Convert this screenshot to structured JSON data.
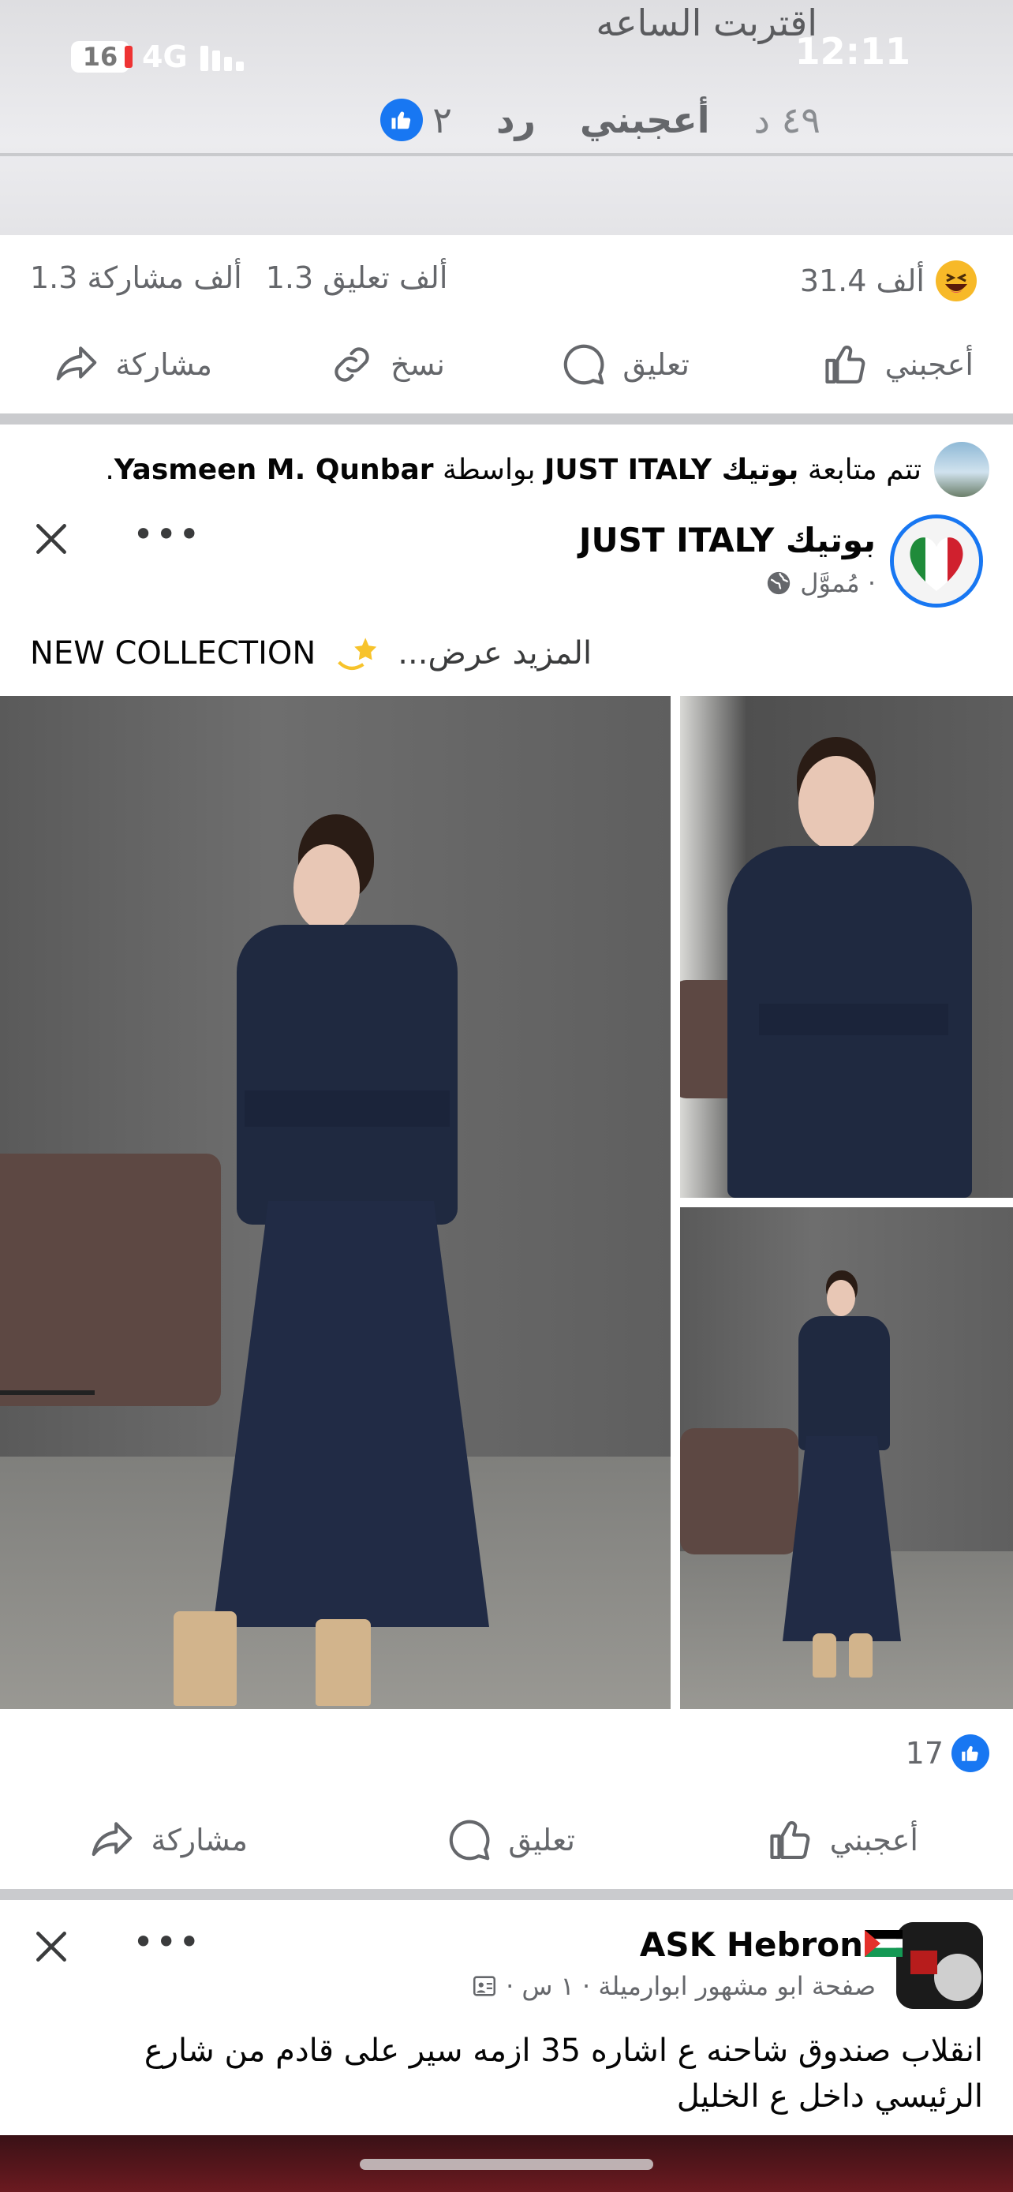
{
  "status_bar": {
    "time": "12:11",
    "battery": "16",
    "network": "4G"
  },
  "previous_comment": {
    "text": "اقتربت الساعه",
    "time": "٤٩ د",
    "like_label": "أعجبني",
    "reply_label": "رد",
    "like_count": "٢"
  },
  "post1": {
    "reactions": "31.4 ألف",
    "comments": "1.3 ألف تعليق",
    "shares": "1.3 ألف مشاركة",
    "actions": {
      "like": "أعجبني",
      "comment": "تعليق",
      "copy": "نسخ",
      "share": "مشاركة"
    }
  },
  "post2": {
    "followed_prefix": "تتم متابعة",
    "followed_page": "بوتيك JUST ITALY",
    "followed_by_word": "بواسطة",
    "followed_user": "Yasmeen M. Qunbar",
    "page_name": "بوتيك JUST ITALY",
    "sponsored": "مُموَّل ·",
    "see_more": "المزيد عرض...",
    "caption": "NEW COLLECTION",
    "likes": "17",
    "actions": {
      "like": "أعجبني",
      "comment": "تعليق",
      "share": "مشاركة"
    }
  },
  "post3": {
    "page_name": "ASK Hebron",
    "meta": "صفحة ابو مشهور ابوارميلة · ١ س ·",
    "text": "انقلاب صندوق شاحنه ع اشاره 35 ازمه سير على قادم من شارع الرئيسي داخل ع الخليل"
  },
  "colors": {
    "accent": "#1877f2",
    "secondary_text": "#65676b",
    "separator": "#cacbce"
  }
}
